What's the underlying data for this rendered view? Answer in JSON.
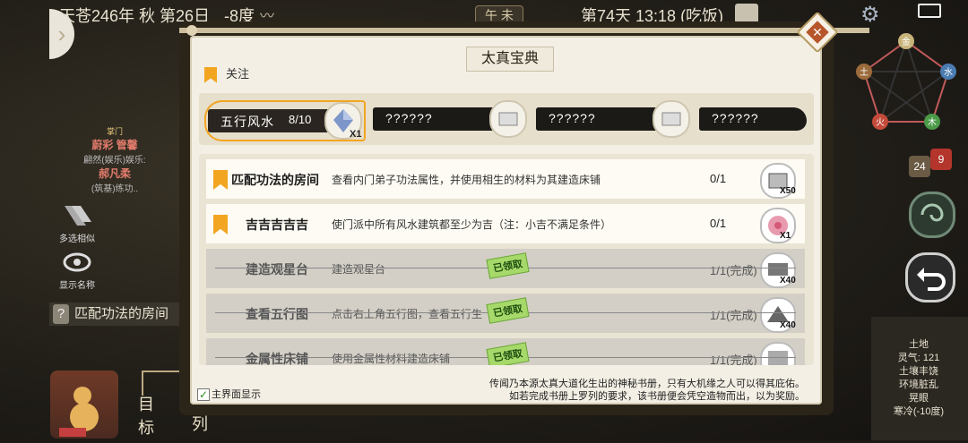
{
  "status_bar": {
    "date": "天苍246年 秋 第26日",
    "temperature": "-8度",
    "time_badge": "午 未",
    "day_time": "第74天 13:18 (吃饭)"
  },
  "left_panel": {
    "sect_label": "掌门",
    "name1": "蔚彩 管馨",
    "activity1": "翩然(娱乐)娱乐:",
    "name2": "郝凡柔",
    "activity2": "(筑基)练功..",
    "btn_multi": "多选相似",
    "btn_show_name": "显示名称",
    "quest_hint": "匹配功法的房间",
    "nav_target": "目标",
    "nav_queue": "队列"
  },
  "panel": {
    "title": "太真宝典",
    "focus_tab": "关注",
    "categories": [
      {
        "label": "五行风水",
        "count": "8/10",
        "reward_mult": "X1"
      },
      {
        "label": "??????",
        "count": "",
        "reward_mult": ""
      },
      {
        "label": "??????",
        "count": "",
        "reward_mult": ""
      },
      {
        "label": "??????",
        "count": "",
        "reward_mult": ""
      }
    ],
    "quests": [
      {
        "name": "匹配功法的房间",
        "desc": "查看内门弟子功法属性，并使用相生的材料为其建造床铺",
        "progress": "0/1",
        "mult": "X50",
        "stamp": ""
      },
      {
        "name": "吉吉吉吉吉",
        "desc": "使门派中所有风水建筑都至少为吉（注：小吉不满足条件）",
        "progress": "0/1",
        "mult": "X1",
        "stamp": ""
      },
      {
        "name": "建造观星台",
        "desc": "建造观星台",
        "progress": "1/1(完成)",
        "mult": "X40",
        "stamp": "已领取"
      },
      {
        "name": "查看五行图",
        "desc": "点击右上角五行图，查看五行生",
        "progress": "1/1(完成)",
        "mult": "X40",
        "stamp": "已领取"
      },
      {
        "name": "金属性床铺",
        "desc": "使用金属性材料建造床铺",
        "progress": "1/1(完成)",
        "mult": "",
        "stamp": "已领取"
      }
    ],
    "show_on_main": "主界面显示",
    "footer_line1": "传闻乃本源太真大道化生出的神秘书册，只有大机缘之人可以得其庇佑。",
    "footer_line2": "如若完成书册上罗列的要求，该书册便会凭空造物而出，以为奖励。"
  },
  "right_panel": {
    "elements": {
      "top": "金",
      "right": "水",
      "bottom_right": "木",
      "bottom_left": "火",
      "left": "土"
    },
    "badge_a": "24",
    "badge_b": "9",
    "terrain_title": "土地",
    "spirit": "灵气: 121",
    "line1": "土壤丰饶",
    "line2": "环境脏乱",
    "line3": "晃眼",
    "line4": "寒冷(-10度)"
  },
  "colors": {
    "accent": "#f2a521",
    "ink": "#1c1a17",
    "claimed": "#a6d96a",
    "panel": "#f3efe4"
  }
}
